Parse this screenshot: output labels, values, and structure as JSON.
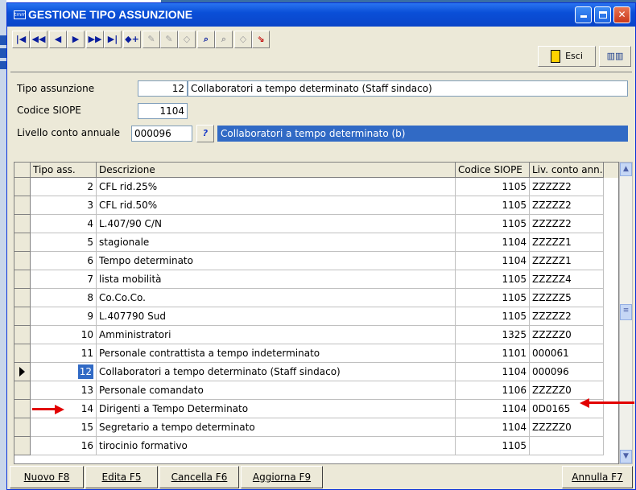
{
  "window": {
    "title": "GESTIONE TIPO ASSUNZIONE",
    "app_icon_text": "tmm"
  },
  "toolbar": {
    "exit_label": "Esci"
  },
  "form": {
    "tipo_label": "Tipo assunzione",
    "tipo_code": "12",
    "tipo_desc": "Collaboratori a tempo determinato (Staff sindaco)",
    "siope_label": "Codice SIOPE",
    "siope_value": "1104",
    "livello_label": "Livello conto annuale",
    "livello_value": "000096",
    "lookup_label": "?",
    "livello_desc": "Collaboratori a tempo determinato (b)"
  },
  "grid": {
    "headers": [
      "Tipo ass.",
      "Descrizione",
      "Codice SIOPE",
      "Liv. conto ann."
    ],
    "rows": [
      {
        "tipo": "2",
        "desc": "CFL rid.25%",
        "siope": "1105",
        "liv": "ZZZZZ2"
      },
      {
        "tipo": "3",
        "desc": "CFL rid.50%",
        "siope": "1105",
        "liv": "ZZZZZ2"
      },
      {
        "tipo": "4",
        "desc": "L.407/90 C/N",
        "siope": "1105",
        "liv": "ZZZZZ2"
      },
      {
        "tipo": "5",
        "desc": "stagionale",
        "siope": "1104",
        "liv": "ZZZZZ1"
      },
      {
        "tipo": "6",
        "desc": "Tempo determinato",
        "siope": "1104",
        "liv": "ZZZZZ1"
      },
      {
        "tipo": "7",
        "desc": "lista mobilità",
        "siope": "1105",
        "liv": "ZZZZZ4"
      },
      {
        "tipo": "8",
        "desc": "Co.Co.Co.",
        "siope": "1105",
        "liv": "ZZZZZ5"
      },
      {
        "tipo": "9",
        "desc": "L.407790 Sud",
        "siope": "1105",
        "liv": "ZZZZZ2"
      },
      {
        "tipo": "10",
        "desc": "Amministratori",
        "siope": "1325",
        "liv": "ZZZZZ0"
      },
      {
        "tipo": "11",
        "desc": "Personale contrattista a tempo indeterminato",
        "siope": "1101",
        "liv": "000061"
      },
      {
        "tipo": "12",
        "desc": "Collaboratori a tempo determinato (Staff sindaco)",
        "siope": "1104",
        "liv": "000096"
      },
      {
        "tipo": "13",
        "desc": "Personale comandato",
        "siope": "1106",
        "liv": "ZZZZZ0"
      },
      {
        "tipo": "14",
        "desc": "Dirigenti a Tempo Determinato",
        "siope": "1104",
        "liv": "0D0165"
      },
      {
        "tipo": "15",
        "desc": "Segretario a tempo determinato",
        "siope": "1104",
        "liv": "ZZZZZ0"
      },
      {
        "tipo": "16",
        "desc": "tirocinio formativo",
        "siope": "1105",
        "liv": ""
      }
    ]
  },
  "buttons": {
    "nuovo": "Nuovo F8",
    "edita": "Edita F5",
    "cancella": "Cancella F6",
    "aggiorna": "Aggiorna F9",
    "annulla": "Annulla F7"
  },
  "colors": {
    "selection": "#316ac5",
    "annotation_arrow": "#e20000",
    "title_bar": "#0a4fd8"
  }
}
